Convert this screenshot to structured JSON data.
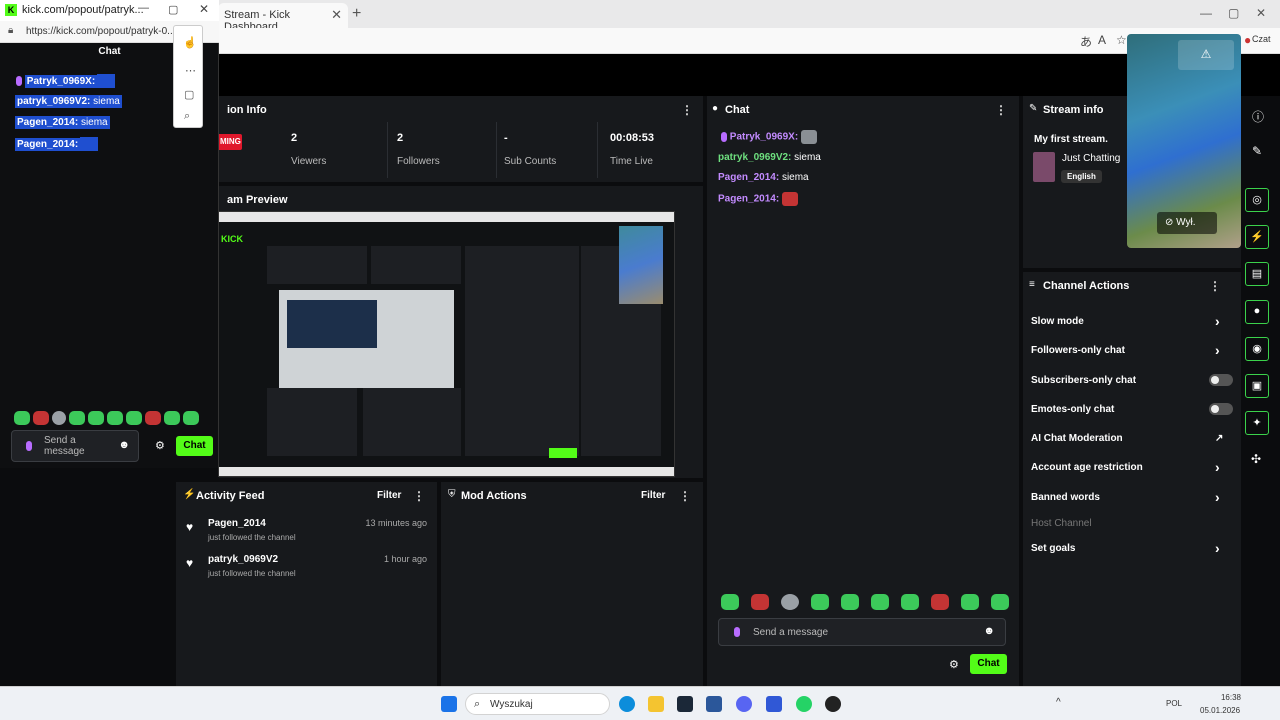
{
  "popout": {
    "title": "kick.com/popout/patryk...",
    "url": "https://kick.com/popout/patryk-0...",
    "chat_header": "Chat",
    "messages": [
      {
        "user": "Patryk_0969X:",
        "text": ""
      },
      {
        "user": "patryk_0969V2:",
        "text": "siema"
      },
      {
        "user": "Pagen_2014:",
        "text": "siema"
      },
      {
        "user": "Pagen_2014:",
        "text": ""
      }
    ],
    "input_placeholder": "Send a message",
    "chat_button": "Chat"
  },
  "browser": {
    "tab_title": "Stream - Kick Dashboard",
    "profile_label": "Czat"
  },
  "session": {
    "header": "ion Info",
    "streaming_label": "MING",
    "stats": [
      {
        "value": "2",
        "label": "Viewers"
      },
      {
        "value": "2",
        "label": "Followers"
      },
      {
        "value": "-",
        "label": "Sub Counts"
      },
      {
        "value": "00:08:53",
        "label": "Time Live"
      }
    ]
  },
  "preview": {
    "header": "am Preview",
    "logo": "KICK"
  },
  "chat": {
    "header": "Chat",
    "messages": [
      {
        "user": "Patryk_0969X:",
        "text": ""
      },
      {
        "user": "patryk_0969V2:",
        "text": "siema"
      },
      {
        "user": "Pagen_2014:",
        "text": "siema"
      },
      {
        "user": "Pagen_2014:",
        "text": ""
      }
    ],
    "input_placeholder": "Send a message",
    "chat_button": "Chat"
  },
  "activity": {
    "header": "Activity Feed",
    "filter": "Filter",
    "items": [
      {
        "user": "Pagen_2014",
        "detail": "just followed the channel",
        "time": "13 minutes ago"
      },
      {
        "user": "patryk_0969V2",
        "detail": "just followed the channel",
        "time": "1 hour ago"
      }
    ]
  },
  "mod_actions": {
    "header": "Mod Actions",
    "filter": "Filter"
  },
  "stream_info": {
    "header": "Stream info",
    "title": "My first stream.",
    "category": "Just Chatting",
    "language": "English"
  },
  "video": {
    "camera_off": "Wył."
  },
  "channel_actions": {
    "header": "Channel Actions",
    "items": [
      {
        "label": "Slow mode",
        "control": "arrow"
      },
      {
        "label": "Followers-only chat",
        "control": "arrow"
      },
      {
        "label": "Subscribers-only chat",
        "control": "toggle"
      },
      {
        "label": "Emotes-only chat",
        "control": "toggle"
      },
      {
        "label": "AI Chat Moderation",
        "control": "external"
      },
      {
        "label": "Account age restriction",
        "control": "arrow"
      },
      {
        "label": "Banned words",
        "control": "arrow"
      },
      {
        "label": "Host Channel",
        "control": "none"
      },
      {
        "label": "Set goals",
        "control": "arrow"
      }
    ]
  },
  "taskbar": {
    "search_placeholder": "Wyszukaj",
    "lang": "POL",
    "time": "16:38",
    "date": "05.01.2026"
  },
  "colors": {
    "accent": "#53fc18",
    "live_red": "#e0182c",
    "mod_name": "#c38bff",
    "viewer_name": "#6ee07f"
  }
}
